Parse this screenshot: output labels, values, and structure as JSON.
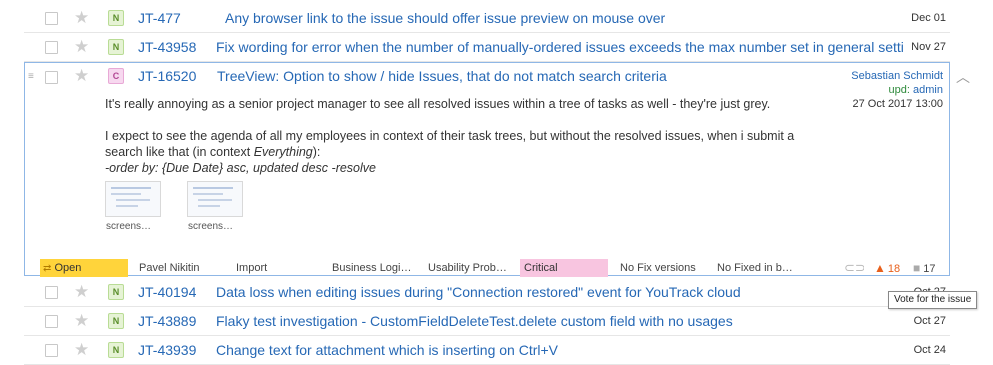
{
  "issues_top": [
    {
      "type": "N",
      "id": "JT-477",
      "summary": "Any browser link to the issue should offer issue preview on mouse over",
      "date": "Dec 01"
    },
    {
      "type": "N",
      "id": "JT-43958",
      "summary": "Fix wording for error when the number of manually-ordered issues exceeds the max number set in general setti",
      "date": "Nov 27"
    }
  ],
  "expanded_issue": {
    "type": "C",
    "id": "JT-16520",
    "summary": "TreeView: Option to show / hide Issues, that do not match search criteria",
    "author": "Sebastian Schmidt",
    "updated_label": "upd:",
    "updated_by": "admin",
    "updated_date": "27 Oct 2017 13:00",
    "description": {
      "line1": "It's really annoying as a senior project manager to see all resolved issues within a tree of tasks as well - they're just grey.",
      "line2": "I expect to see the agenda of all my employees in context of their task trees, but without the resolved issues, when i submit a",
      "line3_prefix": "search like that (in context ",
      "line3_em": "Everything",
      "line3_suffix": "):",
      "line4": "-order by: {Due Date} asc, updated desc -resolve"
    },
    "attachments": [
      {
        "label": "screens…"
      },
      {
        "label": "screens…"
      }
    ],
    "fields": {
      "state": "Open",
      "assignee": "Pavel Nikitin",
      "subsystem": "Import",
      "business": "Business Logi…",
      "usability": "Usability Prob…",
      "priority": "Critical",
      "fix_versions": "No Fix versions",
      "fixed_in": "No Fixed in b…"
    },
    "votes": "18",
    "comments": "17"
  },
  "issues_bottom": [
    {
      "type": "N",
      "id": "JT-40194",
      "summary": "Data loss when editing issues during \"Connection restored\" event for YouTrack cloud",
      "date": "Oct 27"
    },
    {
      "type": "N",
      "id": "JT-43889",
      "summary": "Flaky test investigation - CustomFieldDeleteTest.delete custom field with no usages",
      "date": "Oct 27"
    },
    {
      "type": "N",
      "id": "JT-43939",
      "summary": "Change text for attachment which is inserting on Ctrl+V",
      "date": "Oct 24"
    }
  ],
  "tooltip": "Vote for the issue",
  "colors": {
    "link": "#2668b5",
    "state": "#ffd43b",
    "priority": "#f8c5e0",
    "vote": "#e8601c"
  }
}
